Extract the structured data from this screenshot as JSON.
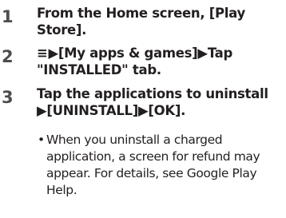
{
  "steps": [
    {
      "number": "1",
      "lines": [
        "From the Home screen, [Play",
        "Store]."
      ]
    },
    {
      "number": "2",
      "menu_glyph": "≡",
      "lines": [
        "▶[My apps & games]▶Tap",
        "\"INSTALLED\" tab."
      ]
    },
    {
      "number": "3",
      "lines": [
        "Tap the applications to uninstall",
        "▶[UNINSTALL]▶[OK]."
      ]
    }
  ],
  "note": {
    "bullet": "•",
    "lines": [
      "When you uninstall a charged",
      "application, a screen for refund may",
      "appear. For details, see Google Play",
      "Help."
    ]
  }
}
